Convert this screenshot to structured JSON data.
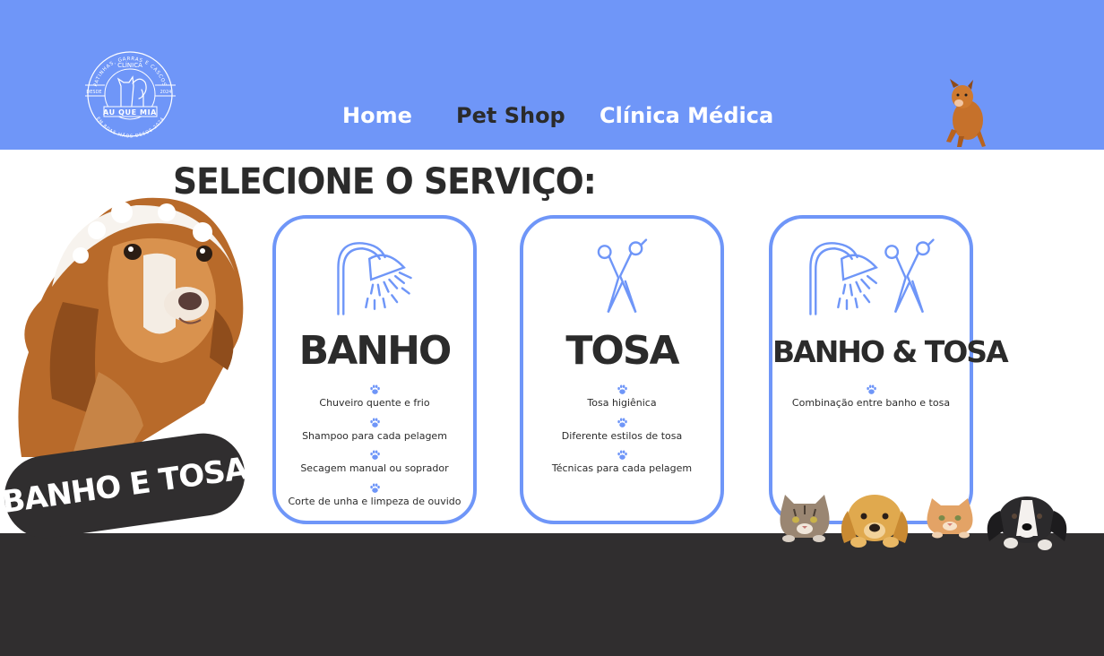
{
  "header": {
    "logo": {
      "top_arc": "PATINHAS, GARRAS E CASCOS",
      "name": "CLÍNICA",
      "left": "DESDE",
      "right": "2024",
      "banner": "AU QUE MIA",
      "bottom_arc": "EM BOAS MÃOS DESDE 2024"
    },
    "nav": [
      "Home",
      "Pet Shop",
      "Clínica Médica"
    ]
  },
  "page_title": "SELECIONE O SERVIÇO:",
  "badge": "BANHO E TOSA",
  "cards": [
    {
      "title": "BANHO",
      "icon": "shower-icon",
      "features": [
        "Chuveiro quente e frio",
        "Shampoo para cada pelagem",
        "Secagem manual ou soprador",
        "Corte de unha e limpeza de ouvido"
      ]
    },
    {
      "title": "TOSA",
      "icon": "scissors-icon",
      "features": [
        "Tosa higiênica",
        "Diferente estilos de tosa",
        "Técnicas para cada pelagem"
      ]
    },
    {
      "title": "BANHO & TOSA",
      "icon": "shower-scissors-icon",
      "features": [
        "Combinação entre banho e tosa"
      ]
    }
  ],
  "colors": {
    "primary": "#6f96f8",
    "dark": "#302e2f",
    "text": "#2b2b2b",
    "background": "#ffffff"
  }
}
